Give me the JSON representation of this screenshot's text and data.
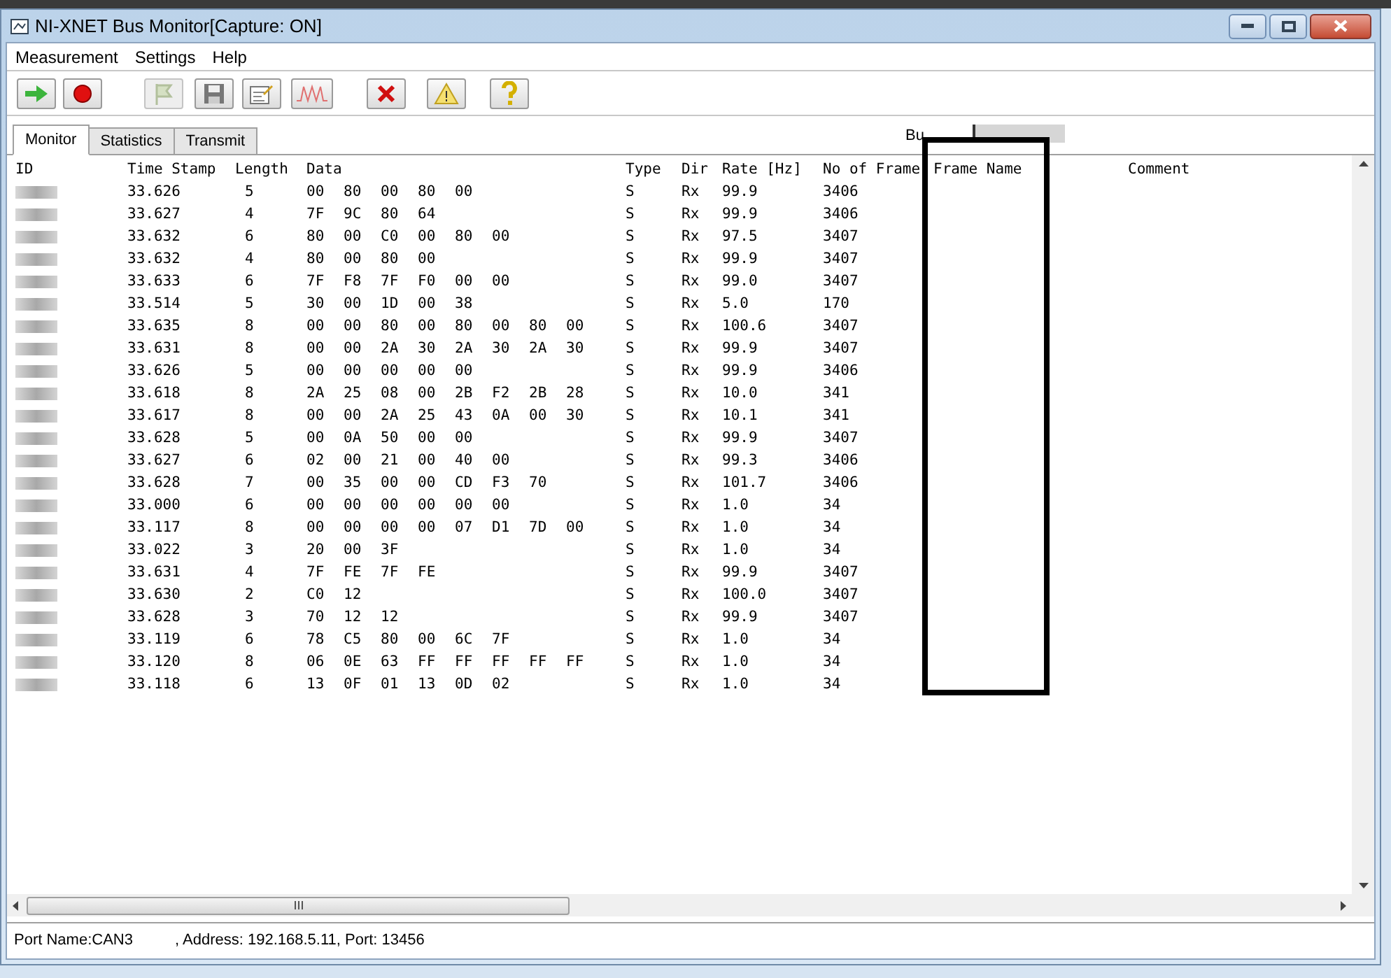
{
  "window": {
    "title": "NI-XNET Bus Monitor[Capture: ON]"
  },
  "menu": [
    "Measurement",
    "Settings",
    "Help"
  ],
  "toolbar": [
    {
      "kind": "start",
      "disabled": false
    },
    {
      "kind": "record",
      "disabled": false
    },
    {
      "kind": "flag",
      "disabled": true
    },
    {
      "kind": "save",
      "disabled": false
    },
    {
      "kind": "edit",
      "disabled": false
    },
    {
      "kind": "wave",
      "disabled": false
    },
    {
      "kind": "clear",
      "disabled": false
    },
    {
      "kind": "warning",
      "disabled": false
    },
    {
      "kind": "help",
      "disabled": false
    }
  ],
  "tabs": [
    {
      "label": "Monitor",
      "selected": true
    },
    {
      "label": "Statistics",
      "selected": false
    },
    {
      "label": "Transmit",
      "selected": false
    }
  ],
  "bus_load": {
    "label": "Bu"
  },
  "table": {
    "columns": [
      "ID",
      "Time Stamp",
      "Length",
      "Data",
      "Type",
      "Dir",
      "Rate [Hz]",
      "No of Frame",
      "Frame Name",
      "Comment"
    ],
    "rows": [
      {
        "time": "33.626",
        "length": "5",
        "data": [
          "00",
          "80",
          "00",
          "80",
          "00"
        ],
        "type": "S",
        "dir": "Rx",
        "rate": "99.9",
        "frames": "3406"
      },
      {
        "time": "33.627",
        "length": "4",
        "data": [
          "7F",
          "9C",
          "80",
          "64"
        ],
        "type": "S",
        "dir": "Rx",
        "rate": "99.9",
        "frames": "3406"
      },
      {
        "time": "33.632",
        "length": "6",
        "data": [
          "80",
          "00",
          "C0",
          "00",
          "80",
          "00"
        ],
        "type": "S",
        "dir": "Rx",
        "rate": "97.5",
        "frames": "3407"
      },
      {
        "time": "33.632",
        "length": "4",
        "data": [
          "80",
          "00",
          "80",
          "00"
        ],
        "type": "S",
        "dir": "Rx",
        "rate": "99.9",
        "frames": "3407"
      },
      {
        "time": "33.633",
        "length": "6",
        "data": [
          "7F",
          "F8",
          "7F",
          "F0",
          "00",
          "00"
        ],
        "type": "S",
        "dir": "Rx",
        "rate": "99.0",
        "frames": "3407"
      },
      {
        "time": "33.514",
        "length": "5",
        "data": [
          "30",
          "00",
          "1D",
          "00",
          "38"
        ],
        "type": "S",
        "dir": "Rx",
        "rate": "5.0",
        "frames": "170"
      },
      {
        "time": "33.635",
        "length": "8",
        "data": [
          "00",
          "00",
          "80",
          "00",
          "80",
          "00",
          "80",
          "00"
        ],
        "type": "S",
        "dir": "Rx",
        "rate": "100.6",
        "frames": "3407"
      },
      {
        "time": "33.631",
        "length": "8",
        "data": [
          "00",
          "00",
          "2A",
          "30",
          "2A",
          "30",
          "2A",
          "30"
        ],
        "type": "S",
        "dir": "Rx",
        "rate": "99.9",
        "frames": "3407"
      },
      {
        "time": "33.626",
        "length": "5",
        "data": [
          "00",
          "00",
          "00",
          "00",
          "00"
        ],
        "type": "S",
        "dir": "Rx",
        "rate": "99.9",
        "frames": "3406"
      },
      {
        "time": "33.618",
        "length": "8",
        "data": [
          "2A",
          "25",
          "08",
          "00",
          "2B",
          "F2",
          "2B",
          "28"
        ],
        "type": "S",
        "dir": "Rx",
        "rate": "10.0",
        "frames": "341"
      },
      {
        "time": "33.617",
        "length": "8",
        "data": [
          "00",
          "00",
          "2A",
          "25",
          "43",
          "0A",
          "00",
          "30"
        ],
        "type": "S",
        "dir": "Rx",
        "rate": "10.1",
        "frames": "341"
      },
      {
        "time": "33.628",
        "length": "5",
        "data": [
          "00",
          "0A",
          "50",
          "00",
          "00"
        ],
        "type": "S",
        "dir": "Rx",
        "rate": "99.9",
        "frames": "3407"
      },
      {
        "time": "33.627",
        "length": "6",
        "data": [
          "02",
          "00",
          "21",
          "00",
          "40",
          "00"
        ],
        "type": "S",
        "dir": "Rx",
        "rate": "99.3",
        "frames": "3406"
      },
      {
        "time": "33.628",
        "length": "7",
        "data": [
          "00",
          "35",
          "00",
          "00",
          "CD",
          "F3",
          "70"
        ],
        "type": "S",
        "dir": "Rx",
        "rate": "101.7",
        "frames": "3406"
      },
      {
        "time": "33.000",
        "length": "6",
        "data": [
          "00",
          "00",
          "00",
          "00",
          "00",
          "00"
        ],
        "type": "S",
        "dir": "Rx",
        "rate": "1.0",
        "frames": "34"
      },
      {
        "time": "33.117",
        "length": "8",
        "data": [
          "00",
          "00",
          "00",
          "00",
          "07",
          "D1",
          "7D",
          "00"
        ],
        "type": "S",
        "dir": "Rx",
        "rate": "1.0",
        "frames": "34"
      },
      {
        "time": "33.022",
        "length": "3",
        "data": [
          "20",
          "00",
          "3F"
        ],
        "type": "S",
        "dir": "Rx",
        "rate": "1.0",
        "frames": "34"
      },
      {
        "time": "33.631",
        "length": "4",
        "data": [
          "7F",
          "FE",
          "7F",
          "FE"
        ],
        "type": "S",
        "dir": "Rx",
        "rate": "99.9",
        "frames": "3407"
      },
      {
        "time": "33.630",
        "length": "2",
        "data": [
          "C0",
          "12"
        ],
        "type": "S",
        "dir": "Rx",
        "rate": "100.0",
        "frames": "3407"
      },
      {
        "time": "33.628",
        "length": "3",
        "data": [
          "70",
          "12",
          "12"
        ],
        "type": "S",
        "dir": "Rx",
        "rate": "99.9",
        "frames": "3407"
      },
      {
        "time": "33.119",
        "length": "6",
        "data": [
          "78",
          "C5",
          "80",
          "00",
          "6C",
          "7F"
        ],
        "type": "S",
        "dir": "Rx",
        "rate": "1.0",
        "frames": "34"
      },
      {
        "time": "33.120",
        "length": "8",
        "data": [
          "06",
          "0E",
          "63",
          "FF",
          "FF",
          "FF",
          "FF",
          "FF"
        ],
        "type": "S",
        "dir": "Rx",
        "rate": "1.0",
        "frames": "34"
      },
      {
        "time": "33.118",
        "length": "6",
        "data": [
          "13",
          "0F",
          "01",
          "13",
          "0D",
          "02"
        ],
        "type": "S",
        "dir": "Rx",
        "rate": "1.0",
        "frames": "34"
      }
    ]
  },
  "status_bar": {
    "port": "Port Name:CAN3",
    "address": ", Address: 192.168.5.11, Port: 13456"
  }
}
